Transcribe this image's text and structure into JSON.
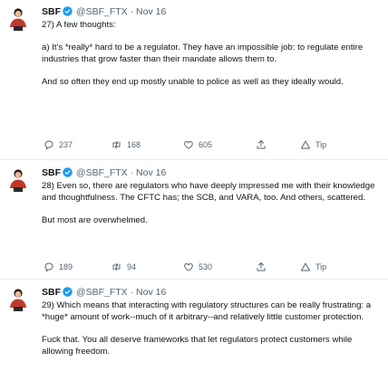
{
  "tweets": [
    {
      "name": "SBF",
      "handle": "@SBF_FTX",
      "dot": "·",
      "date": "Nov 16",
      "paragraphs": [
        "27) A few thoughts:",
        "a) It's *really* hard to be a regulator.  They have an impossible job: to regulate entire industries that grow faster than their mandate allows them to.",
        "And so often they end up mostly unable to police as well as they ideally would."
      ],
      "replies": "237",
      "retweets": "168",
      "likes": "605",
      "tip": "Tip"
    },
    {
      "name": "SBF",
      "handle": "@SBF_FTX",
      "dot": "·",
      "date": "Nov 16",
      "paragraphs": [
        "28) Even so, there are regulators who have deeply impressed me with their knowledge and thoughtfulness.  The CFTC has; the SCB, and VARA, too.  And others, scattered.",
        "But most are overwhelmed."
      ],
      "replies": "189",
      "retweets": "94",
      "likes": "530",
      "tip": "Tip"
    },
    {
      "name": "SBF",
      "handle": "@SBF_FTX",
      "dot": "·",
      "date": "Nov 16",
      "paragraphs": [
        "29) Which means that interacting with regulatory structures can be really frustrating: a *huge* amount of work--much of it arbitrary--and relatively little customer protection.",
        "Fuck that.  You all deserve frameworks that let regulators protect customers while allowing freedom."
      ]
    }
  ],
  "colors": {
    "accent": "#1d9bf0",
    "muted": "#536471",
    "avatar_red": "#c0392b"
  },
  "icons": [
    "avatar-icon",
    "verified-badge-icon",
    "reply-icon",
    "retweet-icon",
    "like-icon",
    "share-icon",
    "tip-icon"
  ]
}
